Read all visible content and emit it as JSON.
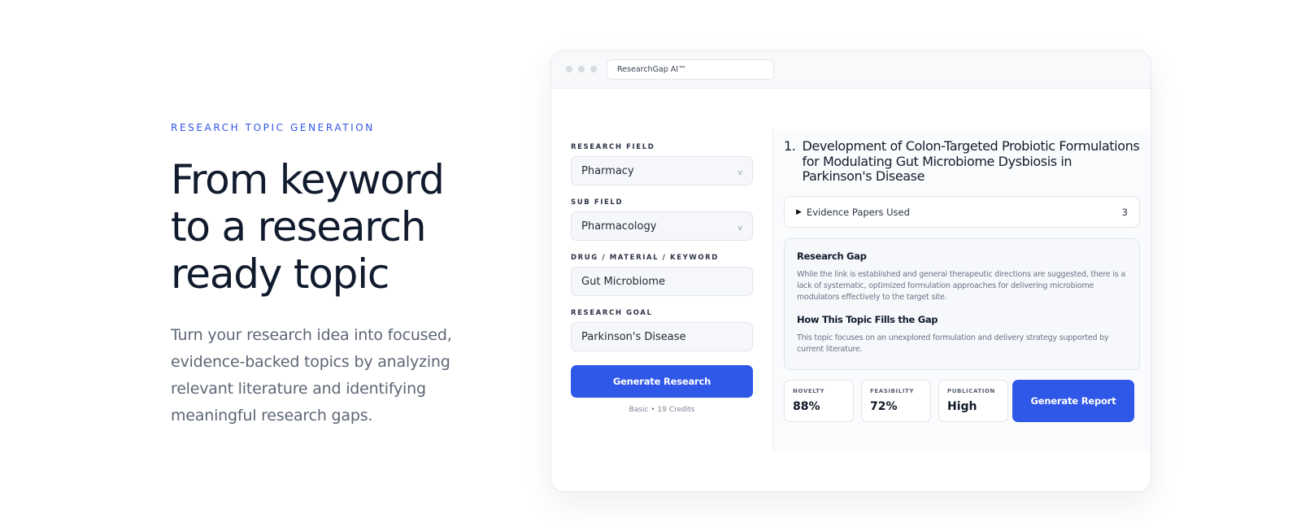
{
  "hero": {
    "eyebrow": "RESEARCH TOPIC GENERATION",
    "headline_lines": [
      "From keyword",
      "to a research",
      "ready topic"
    ],
    "lead_lines": [
      "Turn your research idea into focused,",
      "evidence-backed topics by analyzing",
      "relevant literature and identifying",
      "meaningful research gaps."
    ]
  },
  "browser": {
    "url_text": "ResearchGap AI™"
  },
  "form": {
    "research_field": {
      "label": "RESEARCH FIELD",
      "value": "Pharmacy"
    },
    "sub_field": {
      "label": "SUB FIELD",
      "value": "Pharmacology"
    },
    "keyword": {
      "label": "DRUG / MATERIAL / KEYWORD",
      "value": "Gut Microbiome"
    },
    "goal": {
      "label": "RESEARCH GOAL",
      "value": "Parkinson's Disease"
    },
    "generate_label": "Generate Research",
    "credits": "Basic • 19 Credits",
    "chevron": "v"
  },
  "result": {
    "number": "1.",
    "title": "Development of Colon-Targeted Probiotic Formulations for Modulating Gut Microbiome Dysbiosis in Parkinson's Disease",
    "evidence_label": "Evidence Papers Used",
    "evidence_count": "3",
    "gap_heading": "Research Gap",
    "gap_text": "While the link is established and general therapeutic directions are suggested, there is a lack of systematic, optimized formulation approaches for delivering microbiome modulators effectively to the target site.",
    "fill_heading": "How This Topic Fills the Gap",
    "fill_text": "This topic focuses on an unexplored formulation and delivery strategy supported by current literature.",
    "metrics": [
      {
        "label": "NOVELTY",
        "value": "88%"
      },
      {
        "label": "FEASIBILITY",
        "value": "72%"
      },
      {
        "label": "PUBLICATION",
        "value": "High"
      }
    ],
    "report_label": "Generate Report"
  },
  "colors": {
    "accent": "#2f57e8",
    "eyebrow": "#2f55e4",
    "text": "#111b2e",
    "muted": "#5d6675"
  }
}
